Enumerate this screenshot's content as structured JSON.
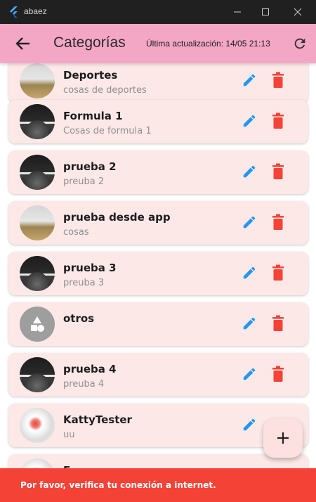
{
  "window": {
    "title": "abaez",
    "icon": "flutter-logo-icon",
    "controls": [
      "minimize-icon",
      "maximize-icon",
      "close-icon"
    ]
  },
  "appbar": {
    "title": "Categorías",
    "updated": "Última actualización: 14/05 21:13",
    "back_icon": "arrow-back-icon",
    "refresh_icon": "refresh-icon"
  },
  "categories": [
    {
      "name": "Deportes",
      "description": "cosas de deportes",
      "avatar": "field-photo"
    },
    {
      "name": "Formula 1",
      "description": "Cosas de formula 1",
      "avatar": "dark-photo"
    },
    {
      "name": "prueba 2",
      "description": "preuba 2",
      "avatar": "dark-photo"
    },
    {
      "name": "prueba desde app",
      "description": "cosas",
      "avatar": "field-photo"
    },
    {
      "name": "prueba 3",
      "description": "preuba 3",
      "avatar": "dark-photo"
    },
    {
      "name": "otros",
      "description": "",
      "avatar": "shapes-icon"
    },
    {
      "name": "prueba 4",
      "description": "preuba 4",
      "avatar": "dark-photo"
    },
    {
      "name": "KattyTester",
      "description": "uu",
      "avatar": "food-photo"
    },
    {
      "name": "F",
      "description": "",
      "avatar": "food-photo"
    }
  ],
  "row_actions": {
    "edit_icon": "edit-icon",
    "delete_icon": "delete-icon"
  },
  "fab": {
    "icon": "add-icon"
  },
  "snackbar": {
    "message": "Por favor, verifica tu conexión a internet."
  },
  "colors": {
    "appbar": "#f4a7c4",
    "card": "#fde8e8",
    "edit": "#2196f3",
    "delete": "#f44336",
    "snackbar": "#f44336",
    "fab": "#fde0e0"
  }
}
